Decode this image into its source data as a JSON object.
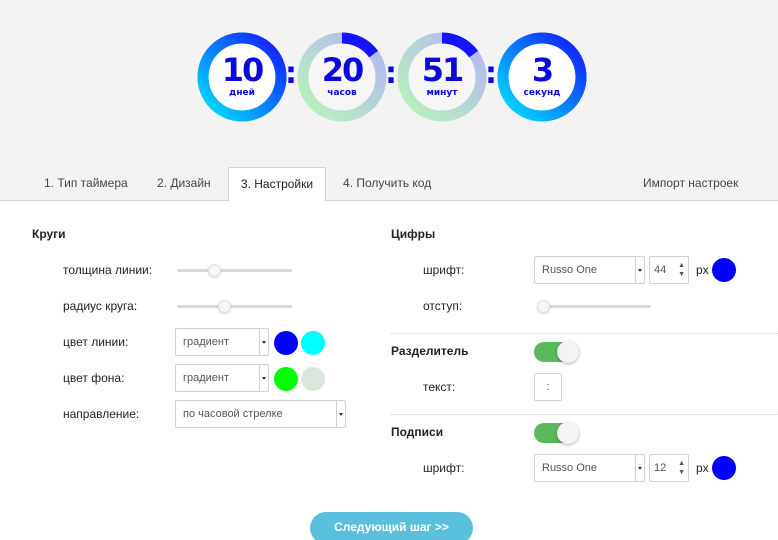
{
  "timer": {
    "units": [
      {
        "value": "10",
        "label": "дней",
        "progress": 0.72,
        "color_from": "#00e5ff",
        "color_to": "#1414ff"
      },
      {
        "value": "20",
        "label": "часов",
        "progress": 0.15,
        "color_from": "#22ff22",
        "color_to": "#1414ff"
      },
      {
        "value": "51",
        "label": "минут",
        "progress": 0.15,
        "color_from": "#22ff22",
        "color_to": "#1414ff"
      },
      {
        "value": "3",
        "label": "секунд",
        "progress": 0.72,
        "color_from": "#00e5ff",
        "color_to": "#1414ff"
      }
    ],
    "separator": ":",
    "digit_color": "#0a0adc"
  },
  "tabs": [
    {
      "label": "1. Тип таймера",
      "active": false
    },
    {
      "label": "2. Дизайн",
      "active": false
    },
    {
      "label": "3. Настройки",
      "active": true
    },
    {
      "label": "4. Получить код",
      "active": false
    }
  ],
  "import_label": "Импорт настроек",
  "circles": {
    "title": "Круги",
    "line_width_label": "толщина линии:",
    "line_width_value": 0.3,
    "radius_label": "радиус круга:",
    "radius_value": 0.4,
    "line_color_label": "цвет линии:",
    "line_color_select": "градиент",
    "line_color_1": "#0000ff",
    "line_color_2": "#00ffff",
    "bg_color_label": "цвет фона:",
    "bg_color_select": "градиент",
    "bg_color_1": "#00ff00",
    "bg_color_2": "#dde6dd",
    "direction_label": "направление:",
    "direction_select": "по часовой стрелке"
  },
  "digits": {
    "title": "Цифры",
    "font_label": "шрифт:",
    "font_select": "Russo One",
    "font_size": "44",
    "unit": "px",
    "color": "#0000ff",
    "offset_label": "отступ:",
    "offset_value": 0.0
  },
  "separator_section": {
    "title": "Разделитель",
    "enabled": true,
    "text_label": "текст:",
    "text_value": ":"
  },
  "labels_section": {
    "title": "Подписи",
    "enabled": true,
    "font_label": "шрифт:",
    "font_select": "Russo One",
    "font_size": "12",
    "unit": "px",
    "color": "#0000ff"
  },
  "next_button": "Следующий шаг >>"
}
